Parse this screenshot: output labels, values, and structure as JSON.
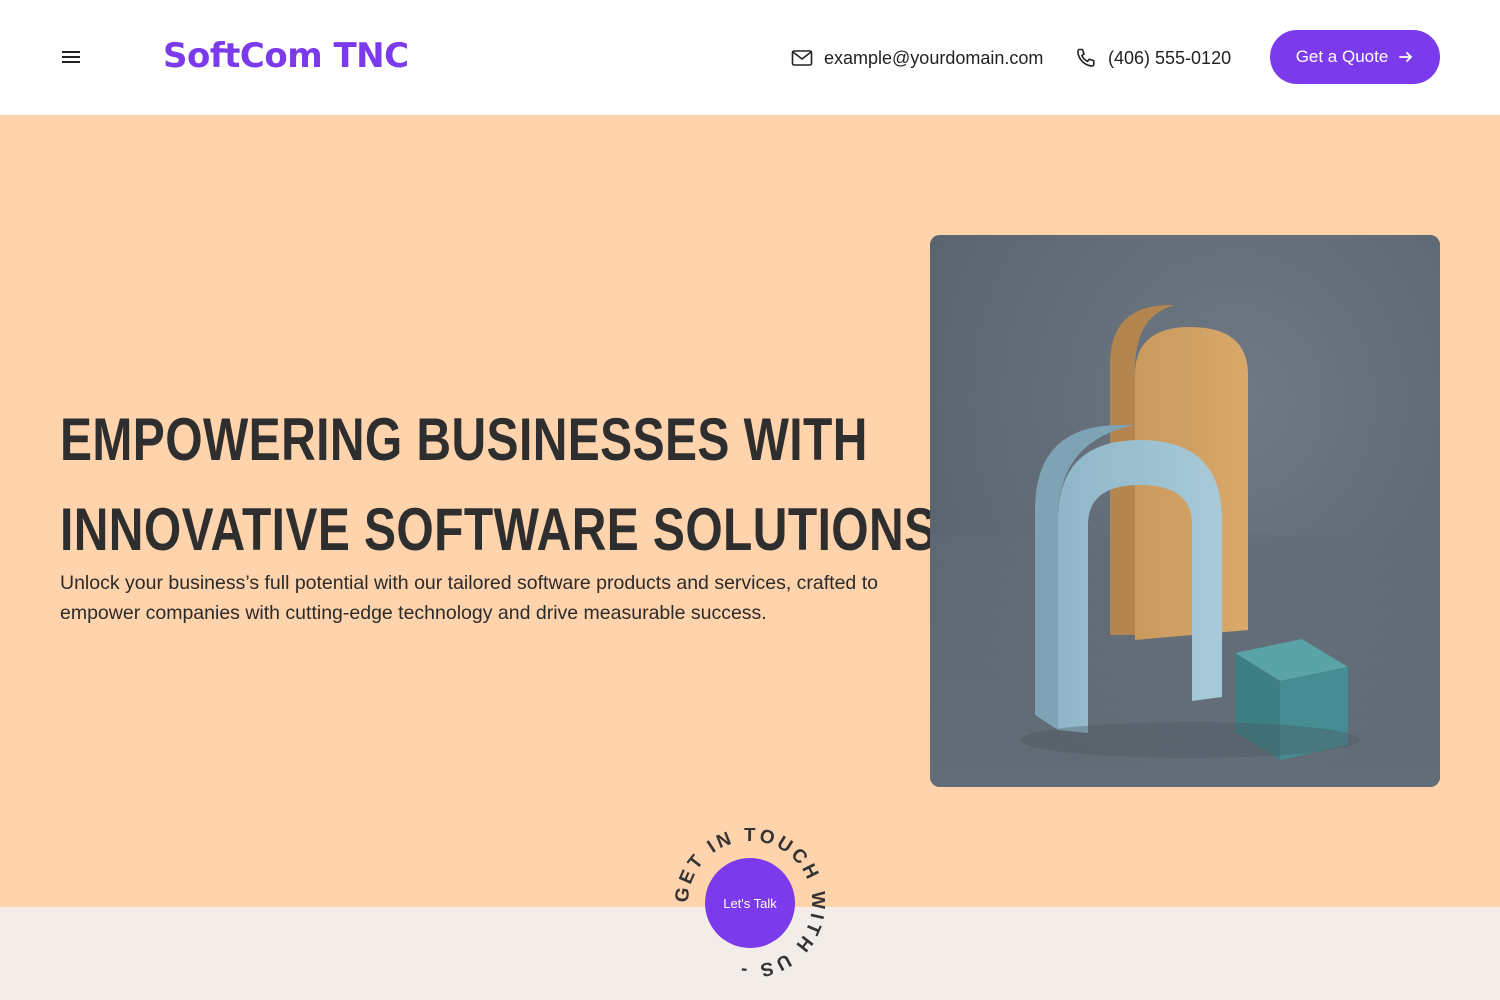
{
  "header": {
    "logo": "SoftCom TNC",
    "email": "example@yourdomain.com",
    "phone": "(406) 555-0120",
    "quote_label": "Get a Quote"
  },
  "hero": {
    "title_line1": "EMPOWERING BUSINESSES WITH",
    "title_line2": "INNOVATIVE SOFTWARE SOLUTIONS",
    "subtitle": "Unlock your business’s full potential with our tailored software products and services, crafted to empower companies with cutting-edge technology and drive measurable success."
  },
  "badge": {
    "center_label": "Let's Talk",
    "ring_text": "GET IN TOUCH WITH US - "
  },
  "icons": {
    "menu": "hamburger-icon",
    "email": "mail-icon",
    "phone": "phone-icon",
    "quote_arrow": "arrow-right-icon"
  },
  "colors": {
    "accent": "#7c3aed",
    "hero_bg": "#ffd3ac",
    "lower_bg": "#f2ede8",
    "text_dark": "#2e2e2e"
  }
}
